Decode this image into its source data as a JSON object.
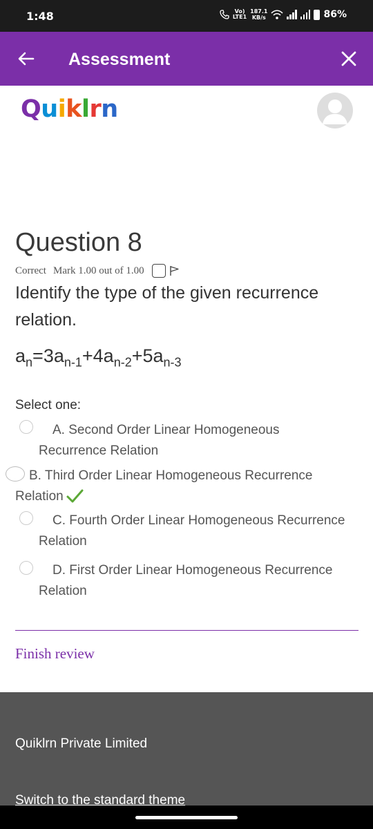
{
  "status_bar": {
    "time": "1:48",
    "volte_top": "Vo)",
    "volte_bottom": "LTE1",
    "net_speed_value": "187.1",
    "net_speed_unit": "KB/s",
    "battery": "86%"
  },
  "app_bar": {
    "title": "Assessment",
    "background_color": "#7b2fa8"
  },
  "brand": {
    "logo_text": "Quiklrn"
  },
  "question": {
    "title": "Question 8",
    "status": "Correct",
    "mark": "Mark 1.00 out of 1.00",
    "text": "Identify the type of the given recurrence relation.",
    "formula": {
      "t1": "a",
      "s1": "n",
      "t2": "=3a",
      "s2": "n-1",
      "t3": "+4a",
      "s3": "n-2",
      "t4": "+5a",
      "s4": "n-3"
    },
    "select_label": "Select one:",
    "options": [
      {
        "line1": "A. Second Order Linear Homogeneous",
        "line2": "Recurrence Relation",
        "selected": false
      },
      {
        "line1": "B. Third Order Linear Homogeneous Recurrence",
        "line2": "Relation",
        "selected": true,
        "correct": true
      },
      {
        "line1": "C. Fourth Order Linear Homogeneous Recurrence",
        "line2": "Relation",
        "selected": false
      },
      {
        "line1": "D. First Order Linear Homogeneous Recurrence",
        "line2": "Relation",
        "selected": false
      }
    ],
    "finish_review": "Finish review"
  },
  "footer": {
    "company": "Quiklrn Private Limited",
    "switch_theme": "Switch to the standard theme"
  }
}
